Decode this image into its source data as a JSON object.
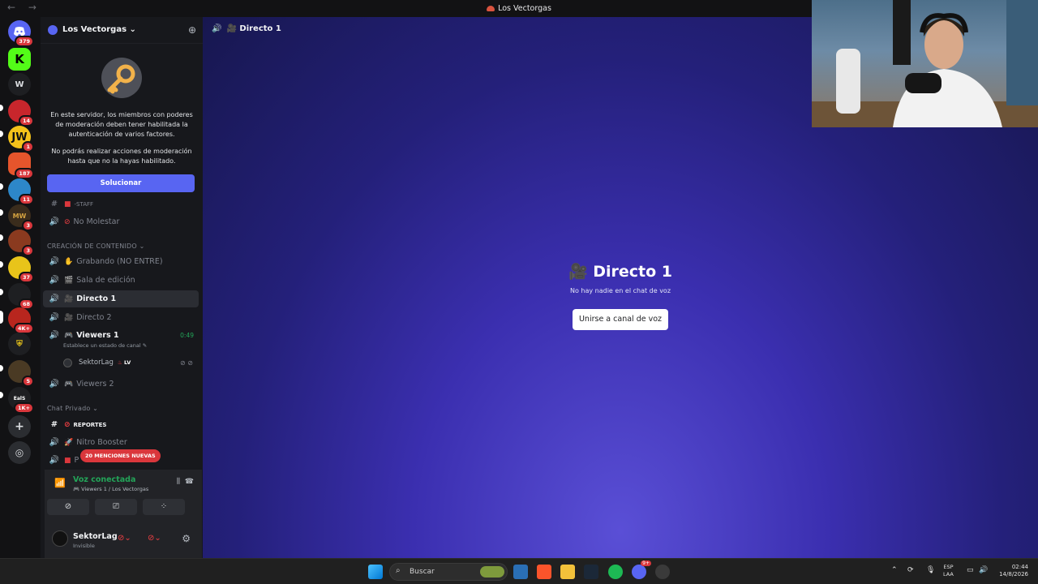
{
  "titlebar": {
    "nav": "← →",
    "title": "Los Vectorgas"
  },
  "rail": {
    "badges": [
      "379",
      "14",
      "1",
      "187",
      "11",
      "3",
      "3",
      "37",
      "68",
      "4K+",
      "5",
      "1K+"
    ],
    "w_label": "W",
    "k_label": "K",
    "eg_label": "EalS"
  },
  "sidebar": {
    "server_name": "Los Vectorgas ⌄",
    "mfa_text_1": "En este servidor, los miembros con poderes de moderación deben tener habilitada la autenticación de varios factores.",
    "mfa_text_2": "No podrás realizar acciones de moderación hasta que no la hayas habilitado.",
    "fix_button": "Solucionar",
    "channels": {
      "staff": "-STAFF",
      "no_molestar": "No Molestar",
      "cat_contenido": "CREACIÓN DE CONTENIDO ⌄",
      "grabando": "Grabando (NO ENTRE)",
      "sala_edicion": "Sala de edición",
      "directo1": "Directo 1",
      "directo2": "Directo 2",
      "viewers1": "Viewers 1",
      "viewers1_timer": "0:49",
      "status_hint": "Establece un estado de canal ✎",
      "member_name": "SektorLag",
      "member_tag": "LV",
      "viewers2": "Viewers 2",
      "cat_privado": "Chat Privado ⌄",
      "reportes": "REPORTES",
      "nitro": "Nitro Booster",
      "p_channel": "P"
    },
    "mentions_badge": "20 MENCIONES NUEVAS"
  },
  "voice": {
    "status": "Voz conectada",
    "location": "Viewers 1 / Los Vectorgas"
  },
  "user": {
    "name": "SektorLag",
    "status": "Invisible"
  },
  "main": {
    "header_channel": "Directo 1",
    "title": "Directo 1",
    "empty_text": "No hay nadie en el chat de voz",
    "join_button": "Unirse a canal de voz"
  },
  "taskbar": {
    "search_label": "Buscar",
    "lang_1": "ESP",
    "lang_2": "LAA",
    "time": "02:44",
    "date": "14/8/2026",
    "discord_badge": "9+"
  }
}
